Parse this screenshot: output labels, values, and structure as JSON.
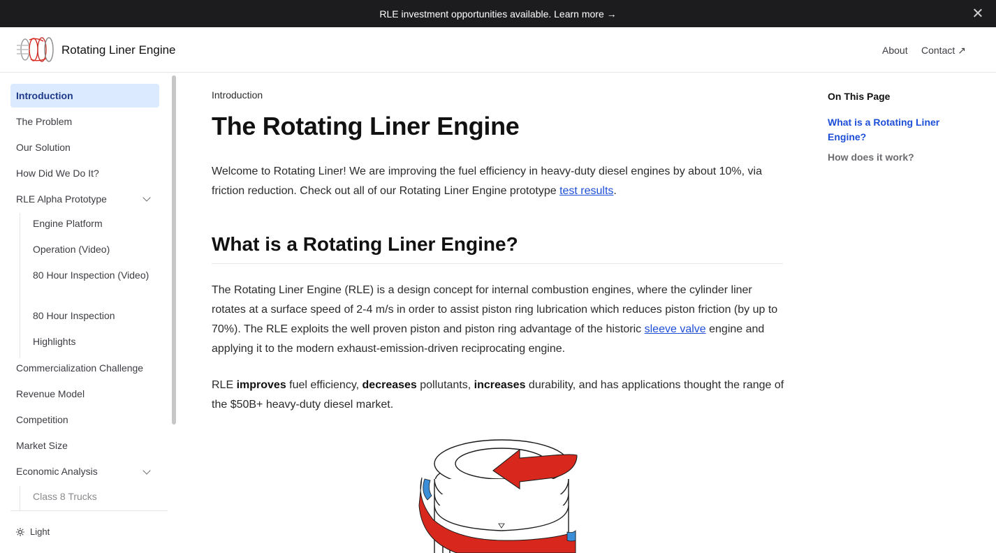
{
  "banner": {
    "text": "RLE investment opportunities available. Learn more →"
  },
  "header": {
    "site_title": "Rotating Liner Engine",
    "about": "About",
    "contact": "Contact ↗"
  },
  "sidebar": {
    "items": [
      {
        "label": "Introduction"
      },
      {
        "label": "The Problem"
      },
      {
        "label": "Our Solution"
      },
      {
        "label": "How Did We Do It?"
      },
      {
        "label": "RLE Alpha Prototype"
      },
      {
        "label": "Commercialization Challenge"
      },
      {
        "label": "Revenue Model"
      },
      {
        "label": "Competition"
      },
      {
        "label": "Market Size"
      },
      {
        "label": "Economic Analysis"
      }
    ],
    "prototype_children": [
      "Engine Platform",
      "Operation (Video)",
      "80 Hour Inspection (Video)",
      "80 Hour Inspection",
      "Highlights"
    ],
    "economic_children": [
      "Class 8 Trucks"
    ],
    "theme_label": "Light"
  },
  "main": {
    "breadcrumb": "Introduction",
    "title": "The Rotating Liner Engine",
    "intro_before_link": "Welcome to Rotating Liner! We are improving the fuel efficiency in heavy-duty diesel engines by about 10%, via friction reduction. Check out all of our Rotating Liner Engine prototype ",
    "intro_link": "test results",
    "intro_after_link": ".",
    "h2": "What is a Rotating Liner Engine?",
    "p2_before_link": "The Rotating Liner Engine (RLE) is a design concept for internal combustion engines, where the cylinder liner rotates at a surface speed of 2-4 m/s in order to assist piston ring lubrication which reduces piston friction (by up to 70%). The RLE exploits the well proven piston and piston ring advantage of the historic ",
    "p2_link": "sleeve valve",
    "p2_after_link": " engine and applying it to the modern exhaust-emission-driven reciprocating engine.",
    "p3_a": "RLE ",
    "p3_b": "improves",
    "p3_c": " fuel efficiency, ",
    "p3_d": "decreases",
    "p3_e": " pollutants, ",
    "p3_f": "increases",
    "p3_g": " durability, and has applications thought the range of the $50B+ heavy-duty diesel market."
  },
  "toc": {
    "title": "On This Page",
    "items": [
      "What is a Rotating Liner Engine?",
      "How does it work?"
    ]
  },
  "colors": {
    "accent": "#1d4ed8",
    "active_bg": "#dbeafe",
    "banner_bg": "#1c1c1e",
    "figure_red": "#d8281e",
    "figure_blue": "#3b8ed8"
  }
}
